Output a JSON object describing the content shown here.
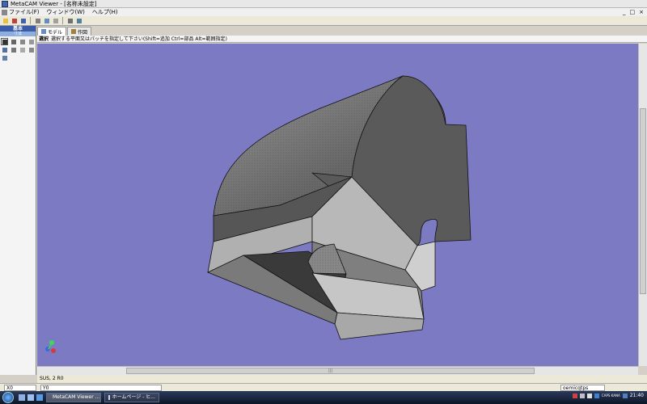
{
  "window": {
    "title": "MetaCAM Viewer - [名称未設定]",
    "controls": [
      "_",
      "□",
      "×"
    ]
  },
  "menu": {
    "items": [
      "ファイル(F)",
      "ウィンドウ(W)",
      "ヘルプ(H)"
    ]
  },
  "left_panel": {
    "header": "基本",
    "subheader": "寸法"
  },
  "tabs": [
    {
      "label": "モデル",
      "active": true
    },
    {
      "label": "作図",
      "active": false
    }
  ],
  "hint": {
    "mode": "選択",
    "text": "選択する平面又はパッチを指定して下さい(Shift=追加 Ctrl=部品 Alt=範囲指定)"
  },
  "status": {
    "material": "SUS, 2 R0"
  },
  "coords": {
    "x_label": "X0",
    "y_label": "Y0",
    "right": "oemicqtps"
  },
  "taskbar": {
    "tasks": [
      "MetaCAM Viewer ...",
      "ホームページ - ヒ..."
    ],
    "clock": "21:40",
    "lang": "CAPS KANA"
  },
  "colors": {
    "viewport_bg": "#7c7ac3",
    "model_face_light": "#b5b5b5",
    "model_face_dark": "#555555"
  }
}
